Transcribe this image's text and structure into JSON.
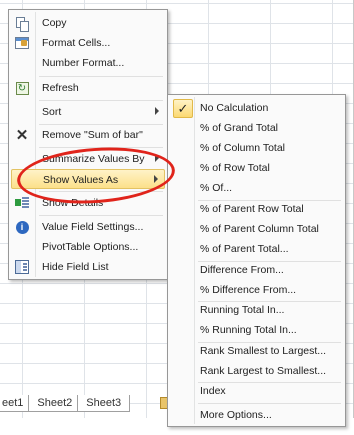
{
  "sheet_tabs": [
    "eet1",
    "Sheet2",
    "Sheet3"
  ],
  "context_menu": {
    "items": [
      {
        "label": "Copy",
        "icon": "copy-icon"
      },
      {
        "label": "Format Cells...",
        "icon": "format-cells-icon"
      },
      {
        "label": "Number Format...",
        "icon": ""
      },
      {
        "label": "Refresh",
        "icon": "refresh-icon"
      },
      {
        "label": "Sort",
        "icon": ""
      },
      {
        "label": "Remove \"Sum of bar\"",
        "icon": "remove-x-icon"
      },
      {
        "label": "Summarize Values By",
        "icon": ""
      },
      {
        "label": "Show Values As",
        "icon": ""
      },
      {
        "label": "Show Details",
        "icon": "show-details-icon"
      },
      {
        "label": "Value Field Settings...",
        "icon": "value-field-settings-icon"
      },
      {
        "label": "PivotTable Options...",
        "icon": ""
      },
      {
        "label": "Hide Field List",
        "icon": "hide-field-list-icon"
      }
    ]
  },
  "submenu": {
    "checked_icon": "✓",
    "items": [
      "No Calculation",
      "% of Grand Total",
      "% of Column Total",
      "% of Row Total",
      "% Of...",
      "% of Parent Row Total",
      "% of Parent Column Total",
      "% of Parent Total...",
      "Difference From...",
      "% Difference From...",
      "Running Total In...",
      "% Running Total In...",
      "Rank Smallest to Largest...",
      "Rank Largest to Smallest...",
      "Index",
      "More Options..."
    ]
  },
  "colors": {
    "highlight": "#fce08a",
    "annotation_ring": "#e0241b"
  }
}
